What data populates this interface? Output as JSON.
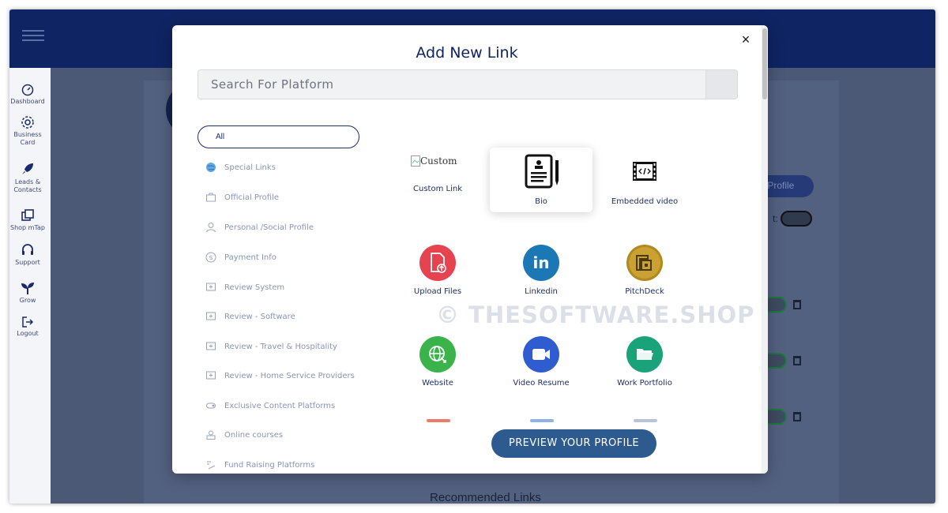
{
  "sidebar": {
    "items": [
      {
        "label": "Dashboard",
        "icon": "dashboard-icon"
      },
      {
        "label": "Business Card",
        "icon": "gear-icon"
      },
      {
        "label": "Leads & Contacts",
        "icon": "rocket-icon"
      },
      {
        "label": "Shop mTap",
        "icon": "shop-icon"
      },
      {
        "label": "Support",
        "icon": "headset-icon"
      },
      {
        "label": "Grow",
        "icon": "sprout-icon"
      },
      {
        "label": "Logout",
        "icon": "logout-icon"
      }
    ]
  },
  "background": {
    "pill_label": "y Profile",
    "toggle_label": "t:",
    "recommended_links": "Recommended Links"
  },
  "modal": {
    "title": "Add New Link",
    "close": "×",
    "search_placeholder": "Search For Platform",
    "preview_button": "PREVIEW YOUR PROFILE",
    "categories": [
      {
        "label": "All",
        "icon": ""
      },
      {
        "label": "Special Links",
        "icon": "globe-icon"
      },
      {
        "label": "Official Profile",
        "icon": "briefcase-icon"
      },
      {
        "label": "Personal /Social Profile",
        "icon": "person-icon"
      },
      {
        "label": "Payment Info",
        "icon": "dollar-icon"
      },
      {
        "label": "Review System",
        "icon": "review-icon"
      },
      {
        "label": "Review - Software",
        "icon": "review-icon"
      },
      {
        "label": "Review - Travel & Hospitality",
        "icon": "review-icon"
      },
      {
        "label": "Review - Home Service Providers",
        "icon": "review-icon"
      },
      {
        "label": "Exclusive Content Platforms",
        "icon": "content-icon"
      },
      {
        "label": "Online courses",
        "icon": "course-icon"
      },
      {
        "label": "Fund Raising Platforms",
        "icon": "fund-icon"
      }
    ],
    "platforms": [
      {
        "label": "Custom Link",
        "alt": "Custom",
        "icon": "broken-image-icon",
        "color": "#ffffff"
      },
      {
        "label": "Bio",
        "icon": "bio-document-icon",
        "color": "#ffffff",
        "selected": true
      },
      {
        "label": "Embedded video",
        "icon": "embed-video-icon",
        "color": "#ffffff"
      },
      {
        "label": "Upload Files",
        "icon": "upload-file-icon",
        "color": "#e5434f"
      },
      {
        "label": "Linkedin",
        "icon": "linkedin-icon",
        "color": "#1b78b5"
      },
      {
        "label": "PitchDeck",
        "icon": "pitchdeck-icon",
        "color": "#b08a20"
      },
      {
        "label": "Website",
        "icon": "website-icon",
        "color": "#3ab34a"
      },
      {
        "label": "Video Resume",
        "icon": "video-camera-icon",
        "color": "#2f5dd0"
      },
      {
        "label": "Work Portfolio",
        "icon": "folder-icon",
        "color": "#1aa37b"
      }
    ]
  },
  "watermark": "© THESOFTWARE.SHOP"
}
